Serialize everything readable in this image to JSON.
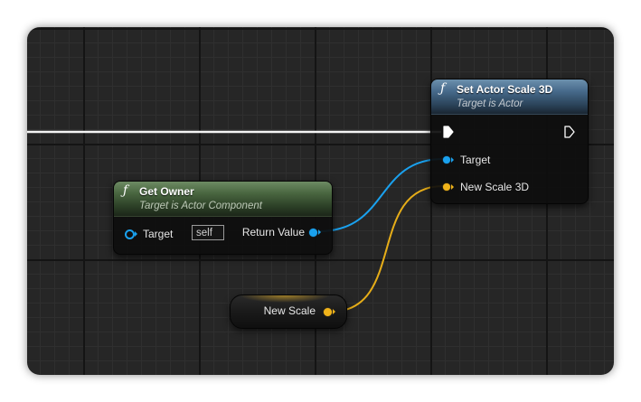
{
  "colors": {
    "exec_wire": "#ffffff",
    "object_pin": "#1aa1ee",
    "vector_pin": "#f0b31a"
  },
  "nodes": {
    "get_owner": {
      "icon": "function-icon",
      "icon_glyph": "ƒ",
      "title": "Get Owner",
      "subtitle": "Target is Actor Component",
      "target_label": "Target",
      "target_default": "self",
      "return_label": "Return Value"
    },
    "set_actor_scale": {
      "icon": "function-icon",
      "icon_glyph": "ƒ",
      "title": "Set Actor Scale 3D",
      "subtitle": "Target is Actor",
      "target_label": "Target",
      "scale_label": "New Scale 3D"
    },
    "new_scale": {
      "label": "New Scale"
    }
  }
}
